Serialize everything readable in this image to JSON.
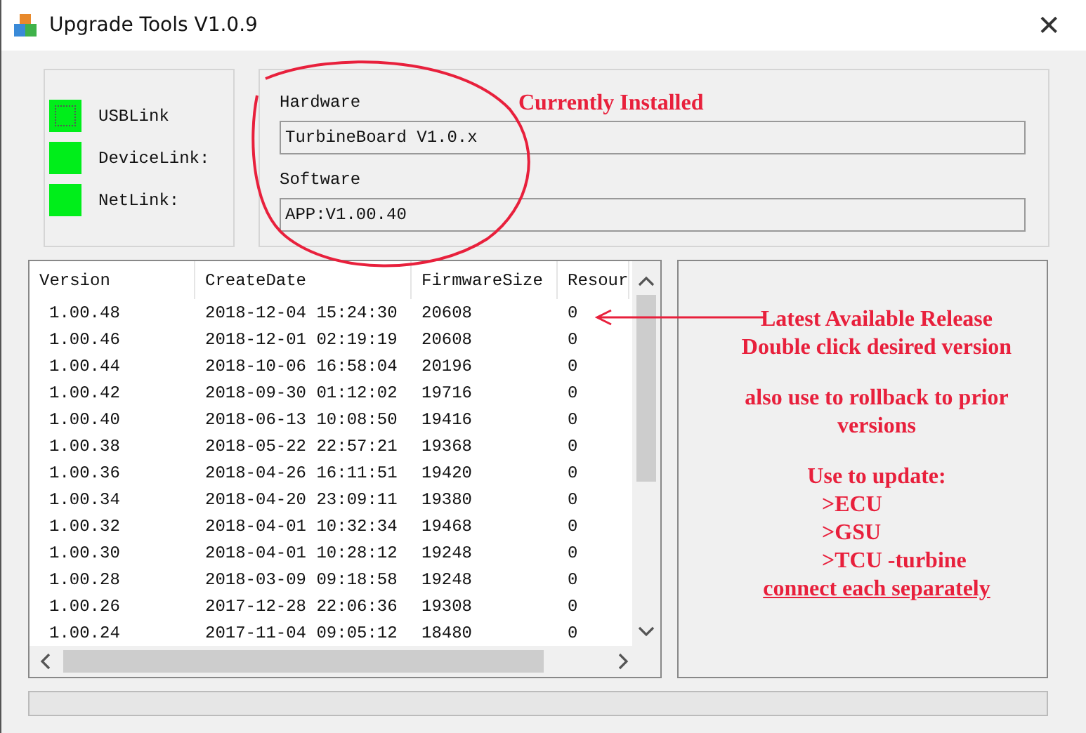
{
  "window": {
    "title": "Upgrade Tools V1.0.9",
    "close": "✕"
  },
  "links": [
    {
      "label": "USBLink",
      "on": true,
      "focused": true
    },
    {
      "label": "DeviceLink:",
      "on": true,
      "focused": false
    },
    {
      "label": "NetLink:",
      "on": true,
      "focused": false
    }
  ],
  "hardware": {
    "label": "Hardware",
    "value": "TurbineBoard V1.0.x"
  },
  "software": {
    "label": "Software",
    "value": "APP:V1.00.40"
  },
  "table": {
    "columns": [
      "Version",
      "CreateDate",
      "FirmwareSize",
      "Resour"
    ],
    "rows": [
      [
        "1.00.48",
        "2018-12-04 15:24:30",
        "20608",
        "0"
      ],
      [
        "1.00.46",
        "2018-12-01 02:19:19",
        "20608",
        "0"
      ],
      [
        "1.00.44",
        "2018-10-06 16:58:04",
        "20196",
        "0"
      ],
      [
        "1.00.42",
        "2018-09-30 01:12:02",
        "19716",
        "0"
      ],
      [
        "1.00.40",
        "2018-06-13 10:08:50",
        "19416",
        "0"
      ],
      [
        "1.00.38",
        "2018-05-22 22:57:21",
        "19368",
        "0"
      ],
      [
        "1.00.36",
        "2018-04-26 16:11:51",
        "19420",
        "0"
      ],
      [
        "1.00.34",
        "2018-04-20 23:09:11",
        "19380",
        "0"
      ],
      [
        "1.00.32",
        "2018-04-01 10:32:34",
        "19468",
        "0"
      ],
      [
        "1.00.30",
        "2018-04-01 10:28:12",
        "19248",
        "0"
      ],
      [
        "1.00.28",
        "2018-03-09 09:18:58",
        "19248",
        "0"
      ],
      [
        "1.00.26",
        "2017-12-28 22:06:36",
        "19308",
        "0"
      ],
      [
        "1.00.24",
        "2017-11-04 09:05:12",
        "18480",
        "0"
      ]
    ]
  },
  "annotations": {
    "installed": "Currently Installed",
    "notes": [
      {
        "text": "Latest Available Release",
        "kind": "line"
      },
      {
        "text": "Double click desired version",
        "kind": "line"
      },
      {
        "text": "also use to rollback to prior versions",
        "kind": "gap"
      },
      {
        "text": "Use to update:",
        "kind": "gap"
      },
      {
        "text": ">ECU",
        "kind": "item"
      },
      {
        "text": ">GSU",
        "kind": "item"
      },
      {
        "text": ">TCU -turbine",
        "kind": "item"
      },
      {
        "text": "connect each separately",
        "kind": "underline"
      }
    ]
  }
}
